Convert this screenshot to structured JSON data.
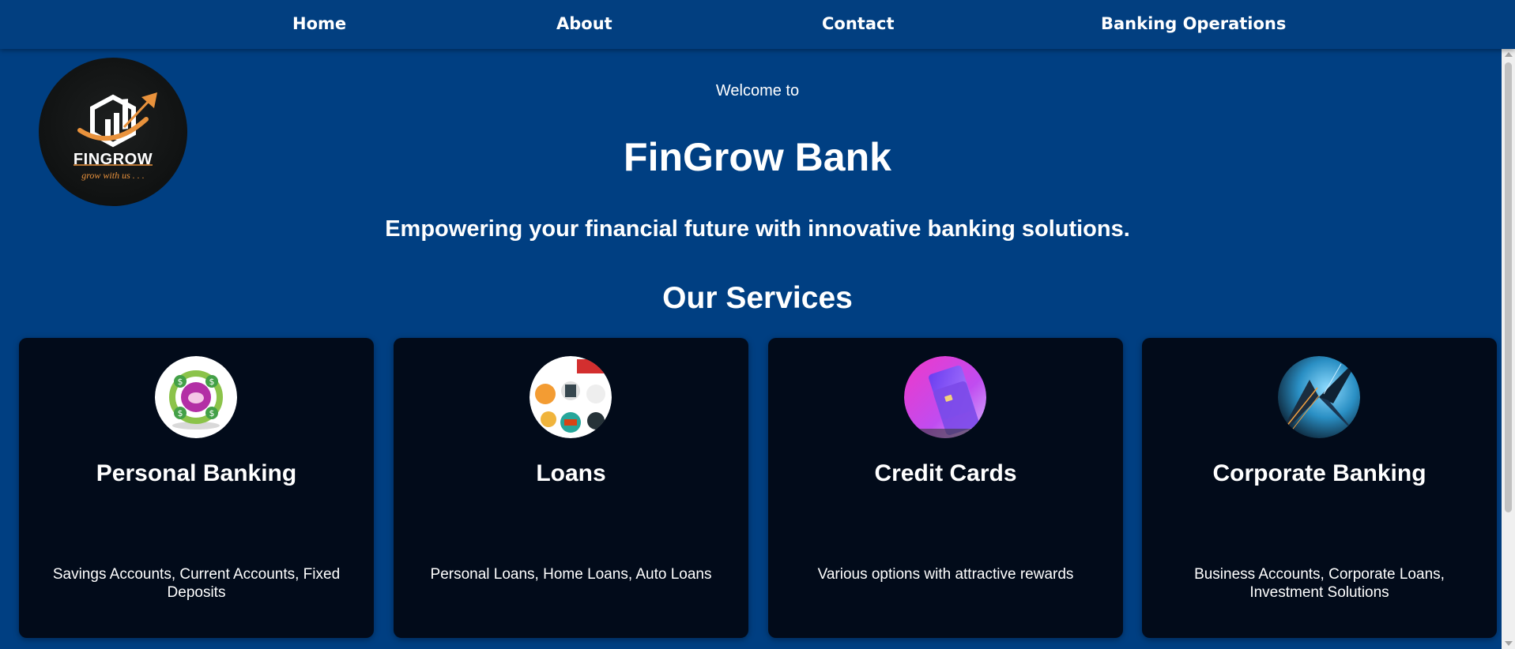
{
  "nav": {
    "home": "Home",
    "about": "About",
    "contact": "Contact",
    "banking_operations": "Banking Operations"
  },
  "logo": {
    "wordmark": "FINGROW",
    "tagline": "grow with us . . ."
  },
  "hero": {
    "welcome": "Welcome to",
    "title": "FinGrow Bank",
    "tagline": "Empowering your financial future with innovative banking solutions."
  },
  "services": {
    "heading": "Our Services",
    "cards": [
      {
        "title": "Personal Banking",
        "description": "Savings Accounts, Current Accounts, Fixed Deposits",
        "icon": "piggy-bank-icon"
      },
      {
        "title": "Loans",
        "description": "Personal Loans, Home Loans, Auto Loans",
        "icon": "loans-collage-icon"
      },
      {
        "title": "Credit Cards",
        "description": "Various options with attractive rewards",
        "icon": "credit-cards-icon"
      },
      {
        "title": "Corporate Banking",
        "description": "Business Accounts, Corporate Loans, Investment Solutions",
        "icon": "skyscraper-icon"
      }
    ]
  },
  "colors": {
    "background": "#003f82",
    "navbar": "#023f80",
    "card": "#020b1a",
    "logo_accent": "#e9923c"
  }
}
